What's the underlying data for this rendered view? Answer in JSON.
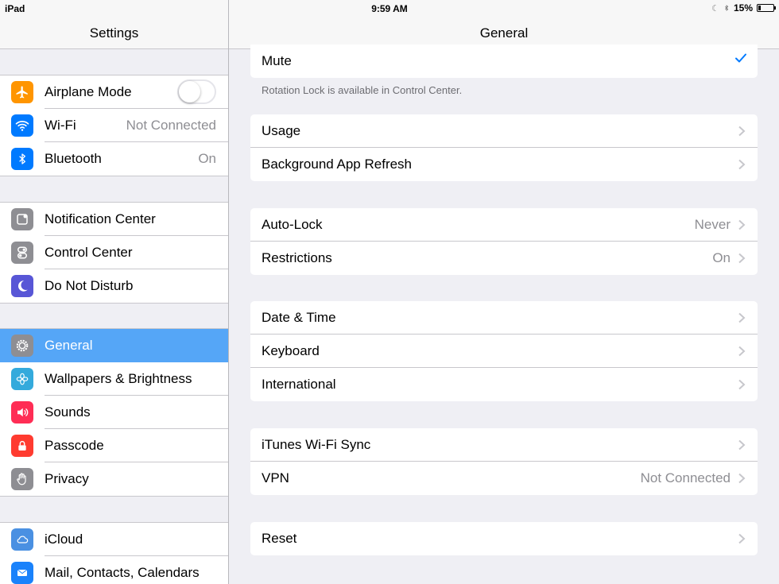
{
  "status_bar": {
    "device": "iPad",
    "time": "9:59 AM",
    "battery": "15%",
    "battery_level": 0.15
  },
  "sidebar": {
    "title": "Settings",
    "groups": [
      [
        {
          "label": "Airplane Mode",
          "icon": "airplane-icon",
          "color": "#ff9500",
          "toggle": false
        },
        {
          "label": "Wi-Fi",
          "value": "Not Connected",
          "icon": "wifi-icon",
          "color": "#007aff"
        },
        {
          "label": "Bluetooth",
          "value": "On",
          "icon": "bluetooth-icon",
          "color": "#007aff"
        }
      ],
      [
        {
          "label": "Notification Center",
          "icon": "notification-center-icon",
          "color": "#8e8e93"
        },
        {
          "label": "Control Center",
          "icon": "control-center-icon",
          "color": "#8e8e93"
        },
        {
          "label": "Do Not Disturb",
          "icon": "moon-icon",
          "color": "#5856d6"
        }
      ],
      [
        {
          "label": "General",
          "icon": "gear-icon",
          "color": "#8e8e93",
          "selected": true
        },
        {
          "label": "Wallpapers & Brightness",
          "icon": "wallpaper-icon",
          "color": "#34aadc"
        },
        {
          "label": "Sounds",
          "icon": "speaker-icon",
          "color": "#ff2d55"
        },
        {
          "label": "Passcode",
          "icon": "lock-icon",
          "color": "#ff3b30"
        },
        {
          "label": "Privacy",
          "icon": "hand-icon",
          "color": "#8e8e93"
        }
      ],
      [
        {
          "label": "iCloud",
          "icon": "cloud-icon",
          "color": "#4a90e2"
        },
        {
          "label": "Mail, Contacts, Calendars",
          "icon": "mail-icon",
          "color": "#1a82fb"
        }
      ]
    ]
  },
  "main": {
    "title": "General",
    "mute_label": "Mute",
    "footnote": "Rotation Lock is available in Control Center.",
    "groups": [
      [
        {
          "label": "Usage"
        },
        {
          "label": "Background App Refresh"
        }
      ],
      [
        {
          "label": "Auto-Lock",
          "value": "Never"
        },
        {
          "label": "Restrictions",
          "value": "On"
        }
      ],
      [
        {
          "label": "Date & Time"
        },
        {
          "label": "Keyboard"
        },
        {
          "label": "International"
        }
      ],
      [
        {
          "label": "iTunes Wi-Fi Sync"
        },
        {
          "label": "VPN",
          "value": "Not Connected"
        }
      ],
      [
        {
          "label": "Reset"
        }
      ]
    ]
  },
  "colors": {
    "accent": "#007aff",
    "selected": "#55a6f7",
    "background": "#efeff4",
    "separator": "#c8c7cc",
    "secondary_text": "#8e8e93"
  }
}
